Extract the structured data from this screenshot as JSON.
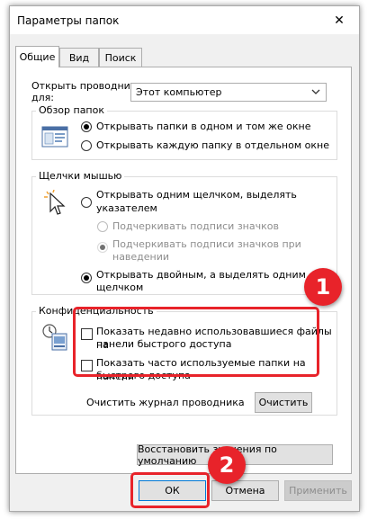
{
  "window": {
    "title": "Параметры папок",
    "close_glyph": "✕"
  },
  "tabs": [
    {
      "label": "Общие",
      "active": true
    },
    {
      "label": "Вид",
      "active": false
    },
    {
      "label": "Поиск",
      "active": false
    }
  ],
  "open_explorer": {
    "label_line1": "Открыть проводник",
    "label_line2": "для:",
    "selected": "Этот компьютер"
  },
  "browse_folders": {
    "title": "Обзор папок",
    "option_same_window": "Открывать папки в одном и том же окне",
    "option_new_window": "Открывать каждую папку в отдельном окне"
  },
  "mouse_clicks": {
    "title": "Щелчки мышью",
    "single_click_line1": "Открывать одним щелчком, выделять",
    "single_click_line2": "указателем",
    "underline_always": "Подчеркивать подписи значков",
    "underline_hover_line1": "Подчеркивать подписи значков при",
    "underline_hover_line2": "наведении",
    "double_click_line1": "Открывать двойным, а выделять одним",
    "double_click_line2": "щелчком"
  },
  "privacy": {
    "title": "Конфиденциальность",
    "recent_files_line1": "Показать недавно использовавшиеся файлы на",
    "recent_files_line2": "панели быстрого доступа",
    "frequent_folders_line1": "Показать часто используемые папки на панели",
    "frequent_folders_line2": "быстрого доступа",
    "clear_history_label": "Очистить журнал проводника",
    "clear_button": "Очистить"
  },
  "restore_defaults_button": "Восстановить значения по умолчанию",
  "footer": {
    "ok": "ОК",
    "cancel": "Отмена",
    "apply": "Применить"
  },
  "annotations": {
    "marker_1": "1",
    "marker_2": "2",
    "color": "#e8232a"
  }
}
